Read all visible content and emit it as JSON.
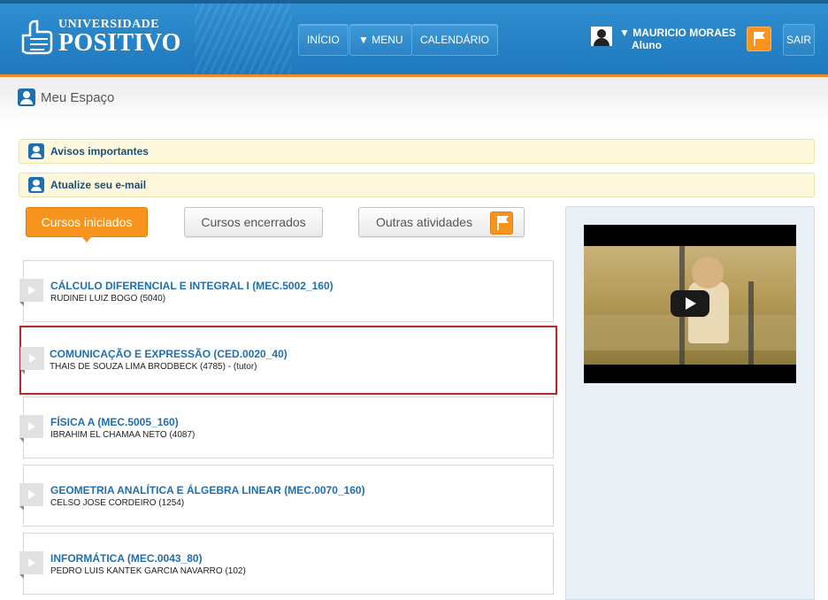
{
  "header": {
    "logo_line1": "UNIVERSIDADE",
    "logo_line2": "POSITIVO",
    "nav": {
      "home": "INÍCIO",
      "menu": "▼ MENU",
      "calendar": "CALENDÁRIO"
    },
    "user": {
      "name": "▼ MAURICIO MORAES",
      "role": "Aluno"
    },
    "exit": "SAIR",
    "colors": {
      "header": "#2f8fd0",
      "accent": "#f7941e"
    }
  },
  "page": {
    "title": "Meu Espaço"
  },
  "notices": [
    {
      "label": "Avisos importantes"
    },
    {
      "label": "Atualize seu e-mail"
    }
  ],
  "tabs": {
    "started": "Cursos iniciados",
    "finished": "Cursos encerrados",
    "other": "Outras atividades"
  },
  "courses": [
    {
      "title": "CÁLCULO DIFERENCIAL E INTEGRAL I (MEC.5002_160)",
      "teacher": "RUDINEI LUIZ BOGO (5040)"
    },
    {
      "title": "COMUNICAÇÃO E EXPRESSÃO (CED.0020_40)",
      "teacher": "THAIS DE SOUZA LIMA BRODBECK (4785) - (tutor)"
    },
    {
      "title": "FÍSICA A (MEC.5005_160)",
      "teacher": "IBRAHIM EL CHAMAA NETO (4087)"
    },
    {
      "title": "GEOMETRIA ANALÍTICA E ÁLGEBRA LINEAR (MEC.0070_160)",
      "teacher": "CELSO JOSE CORDEIRO (1254)"
    },
    {
      "title": "INFORMÁTICA (MEC.0043_80)",
      "teacher": "PEDRO LUIS KANTEK GARCIA NAVARRO (102)"
    }
  ]
}
